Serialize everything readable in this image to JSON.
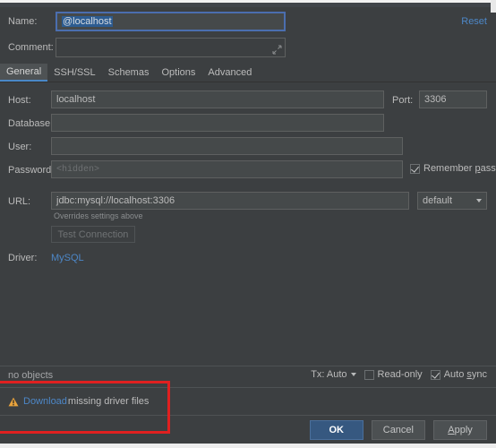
{
  "header": {
    "name_label": "Name:",
    "name_value_selected": "@localhost",
    "reset_label": "Reset",
    "comment_label": "Comment:",
    "comment_value": "",
    "resize_grip_icon": "resize-grip-icon"
  },
  "tabs": [
    {
      "label": "General",
      "active": true
    },
    {
      "label": "SSH/SSL",
      "active": false
    },
    {
      "label": "Schemas",
      "active": false
    },
    {
      "label": "Options",
      "active": false
    },
    {
      "label": "Advanced",
      "active": false
    }
  ],
  "general": {
    "host_label": "Host:",
    "host_value": "localhost",
    "port_label": "Port:",
    "port_value": "3306",
    "database_label": "Database:",
    "database_value": "",
    "user_label": "User:",
    "user_value": "",
    "password_label": "Password:",
    "password_placeholder": "<hidden>",
    "remember_password_label_pre": "Remember ",
    "remember_password_label_mnemonic": "p",
    "remember_password_label_post": "assword",
    "remember_password_checked": true,
    "url_label": "URL:",
    "url_value": "jdbc:mysql://localhost:3306",
    "url_hint": "Overrides settings above",
    "scheme_selected": "default",
    "scheme_caret_icon": "chevron-down-icon",
    "test_connection_label": "Test Connection",
    "driver_label": "Driver:",
    "driver_value": "MySQL"
  },
  "status": {
    "objects_text": "no objects",
    "tx_label": "Tx: Auto",
    "tx_caret_icon": "chevron-down-icon",
    "readonly_label": "Read-only",
    "readonly_checked": false,
    "autosync_label_pre": "Auto ",
    "autosync_label_mnemonic": "s",
    "autosync_label_post": "ync",
    "autosync_checked": true
  },
  "warning": {
    "warning_icon": "warning-triangle-icon",
    "link_label": "Download",
    "text_label": " missing driver files"
  },
  "footer": {
    "ok_label": "OK",
    "cancel_label": "Cancel",
    "apply_label_mnemonic": "A",
    "apply_label_rest": "pply"
  },
  "colors": {
    "background": "#3c3f41",
    "field_bg": "#45494a",
    "accent_blue": "#4d87c7",
    "primary_button": "#365880",
    "selection_blue": "#2d5c91",
    "warning_amber": "#e8a33d",
    "annotation_red": "#e02020",
    "text": "#bbbbbb"
  }
}
